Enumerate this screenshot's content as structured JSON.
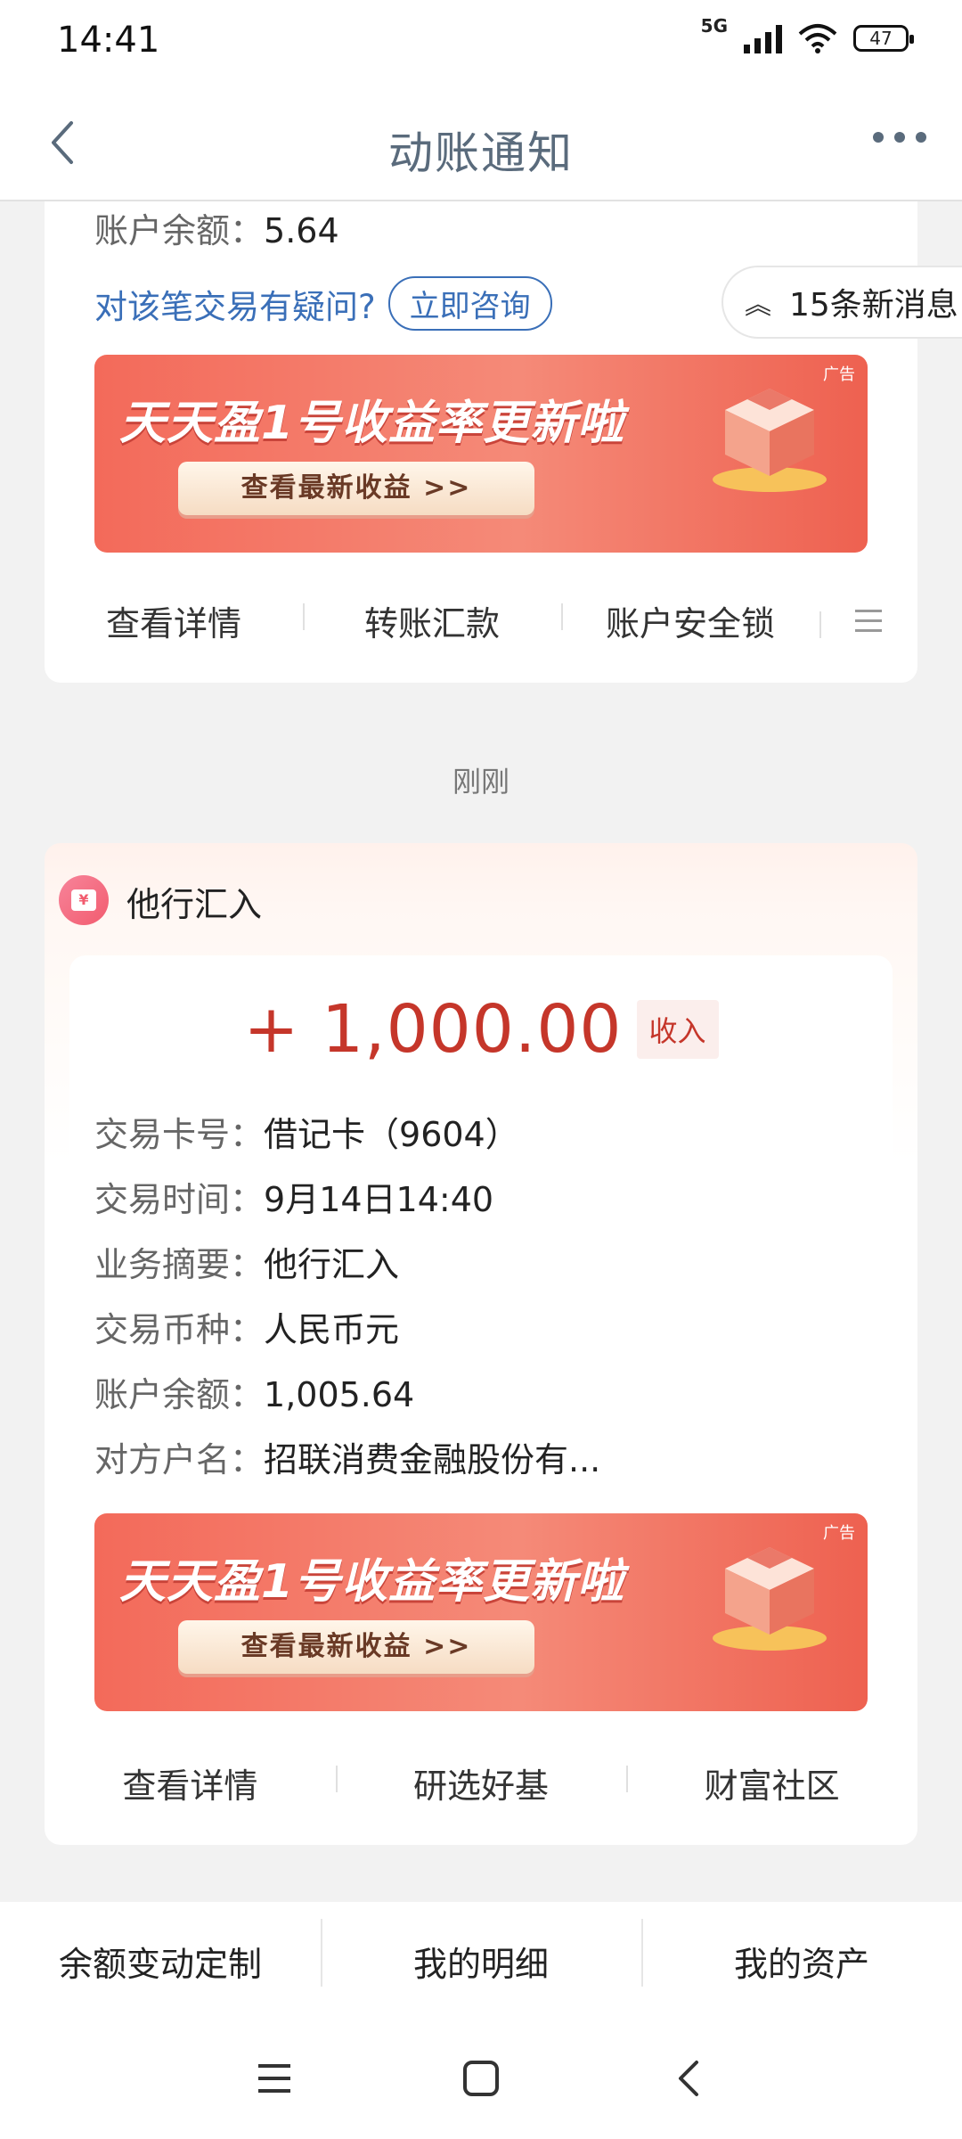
{
  "status_bar": {
    "time": "14:41",
    "network": "5G",
    "battery": "47"
  },
  "nav": {
    "title": "动账通知"
  },
  "card_prev": {
    "balance_label": "账户余额：",
    "balance_value": "5.64",
    "question_text": "对该笔交易有疑问?",
    "consult_label": "立即咨询",
    "actions": [
      "查看详情",
      "转账汇款",
      "账户安全锁"
    ]
  },
  "new_messages": {
    "label": "15条新消息"
  },
  "ad": {
    "tag": "广告",
    "headline": "天天盈1号收益率更新啦",
    "button": "查看最新收益 >>"
  },
  "time_separator": "刚刚",
  "card_current": {
    "type_icon": "yen-card-icon",
    "type_title": "他行汇入",
    "amount": "+ 1,000.00",
    "amount_badge": "收入",
    "fields": [
      {
        "label": "交易卡号：",
        "value": "借记卡（9604）"
      },
      {
        "label": "交易时间：",
        "value": "9月14日14:40"
      },
      {
        "label": "业务摘要：",
        "value": "他行汇入"
      },
      {
        "label": "交易币种：",
        "value": "人民币元"
      },
      {
        "label": "账户余额：",
        "value": "1,005.64"
      },
      {
        "label": "对方户名：",
        "value": "招联消费金融股份有..."
      }
    ],
    "actions": [
      "查看详情",
      "研选好基",
      "财富社区"
    ]
  },
  "bottom_bar": [
    "余额变动定制",
    "我的明细",
    "我的资产"
  ],
  "colors": {
    "accent_red": "#c5362a",
    "link_blue": "#3a6fb8",
    "nav_title": "#5a6b7c"
  }
}
